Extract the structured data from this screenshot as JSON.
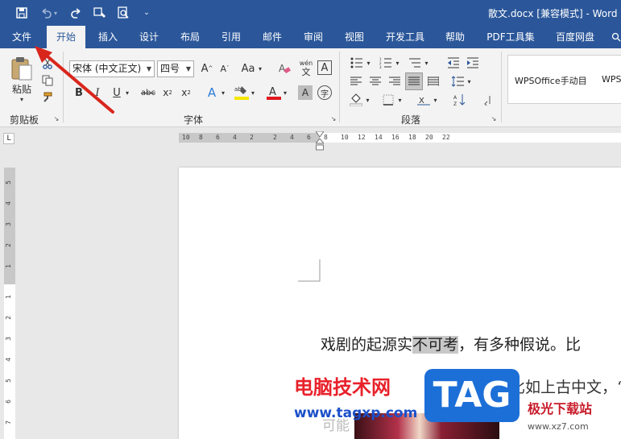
{
  "titlebar": {
    "title": "散文.docx [兼容模式] - Word",
    "quick_access": [
      "save-icon",
      "undo-icon",
      "redo-icon",
      "touch-mode-icon",
      "print-preview-icon",
      "customize-icon"
    ]
  },
  "menu": {
    "tabs": [
      "文件",
      "开始",
      "插入",
      "设计",
      "布局",
      "引用",
      "邮件",
      "审阅",
      "视图",
      "开发工具",
      "帮助",
      "PDF工具集",
      "百度网盘"
    ],
    "active": "开始"
  },
  "ribbon": {
    "clipboard": {
      "paste_label": "粘贴",
      "group_label": "剪贴板"
    },
    "font": {
      "font_name": "宋体 (中文正文)",
      "font_size": "四号",
      "group_label": "字体",
      "aa_label": "Aa",
      "wen_label": "wén"
    },
    "paragraph": {
      "group_label": "段落"
    },
    "styles": {
      "items": [
        "WPSOffice手动目",
        "WPS"
      ]
    }
  },
  "ruler": {
    "h_labels": [
      "10",
      "8",
      "6",
      "4",
      "2",
      "2",
      "4",
      "6",
      "8",
      "10",
      "12",
      "14",
      "16",
      "18",
      "20",
      "22"
    ],
    "v_labels": [
      "5",
      "4",
      "3",
      "2",
      "1",
      "1",
      "2",
      "3",
      "4",
      "5",
      "6",
      "7"
    ]
  },
  "document": {
    "line1_before": "戏剧的起源实",
    "line1_highlight": "不可考",
    "line1_after": "，有多种假说。比",
    "line2_faded": "，比如上古中文，“",
    "line3": "可能"
  },
  "watermark": {
    "cn_text": "电脑技术网",
    "url": "www.tagxp.com",
    "tag": "TAG",
    "site_cn": "极光下载站",
    "site_url": "www.xz7.com"
  },
  "colors": {
    "brand": "#2b579a",
    "arrow": "#d9261c"
  }
}
